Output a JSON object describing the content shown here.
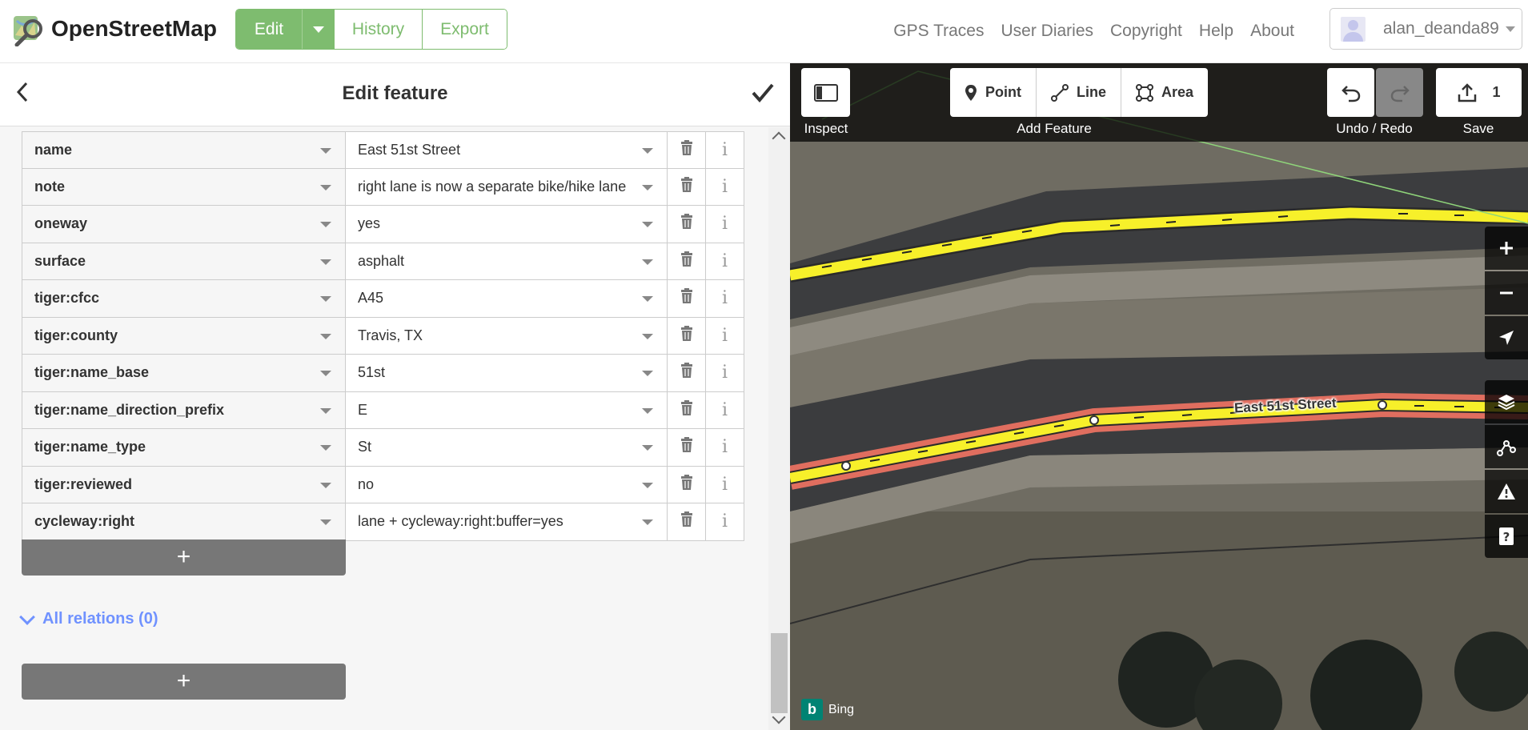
{
  "header": {
    "brand": "OpenStreetMap",
    "edit_label": "Edit",
    "history_label": "History",
    "export_label": "Export",
    "nav": [
      "GPS Traces",
      "User Diaries",
      "Copyright",
      "Help",
      "About"
    ],
    "username": "alan_deanda89"
  },
  "sidebar": {
    "title": "Edit feature",
    "tags": [
      {
        "key": "name",
        "value": "East 51st Street"
      },
      {
        "key": "note",
        "value": "right lane is now a separate bike/hike lane"
      },
      {
        "key": "oneway",
        "value": "yes"
      },
      {
        "key": "surface",
        "value": "asphalt"
      },
      {
        "key": "tiger:cfcc",
        "value": "A45"
      },
      {
        "key": "tiger:county",
        "value": "Travis, TX"
      },
      {
        "key": "tiger:name_base",
        "value": "51st"
      },
      {
        "key": "tiger:name_direction_prefix",
        "value": "E"
      },
      {
        "key": "tiger:name_type",
        "value": "St"
      },
      {
        "key": "tiger:reviewed",
        "value": "no"
      },
      {
        "key": "cycleway:right",
        "value": "lane + cycleway:right:buffer=yes"
      }
    ],
    "add_tag_label": "+",
    "relations_label": "All relations (0)",
    "add_relation_label": "+"
  },
  "map": {
    "inspect_label": "Inspect",
    "point_label": "Point",
    "line_label": "Line",
    "area_label": "Area",
    "add_feature_label": "Add Feature",
    "undo_redo_label": "Undo / Redo",
    "save_count": "1",
    "save_label": "Save",
    "street_label": "East 51st Street",
    "imagery_label": "Bing"
  },
  "colors": {
    "osm_green": "#7ebc6f",
    "relations_blue": "#7092ff",
    "highlight_yellow": "#f7f02a",
    "selected_red": "#e06e5f"
  }
}
